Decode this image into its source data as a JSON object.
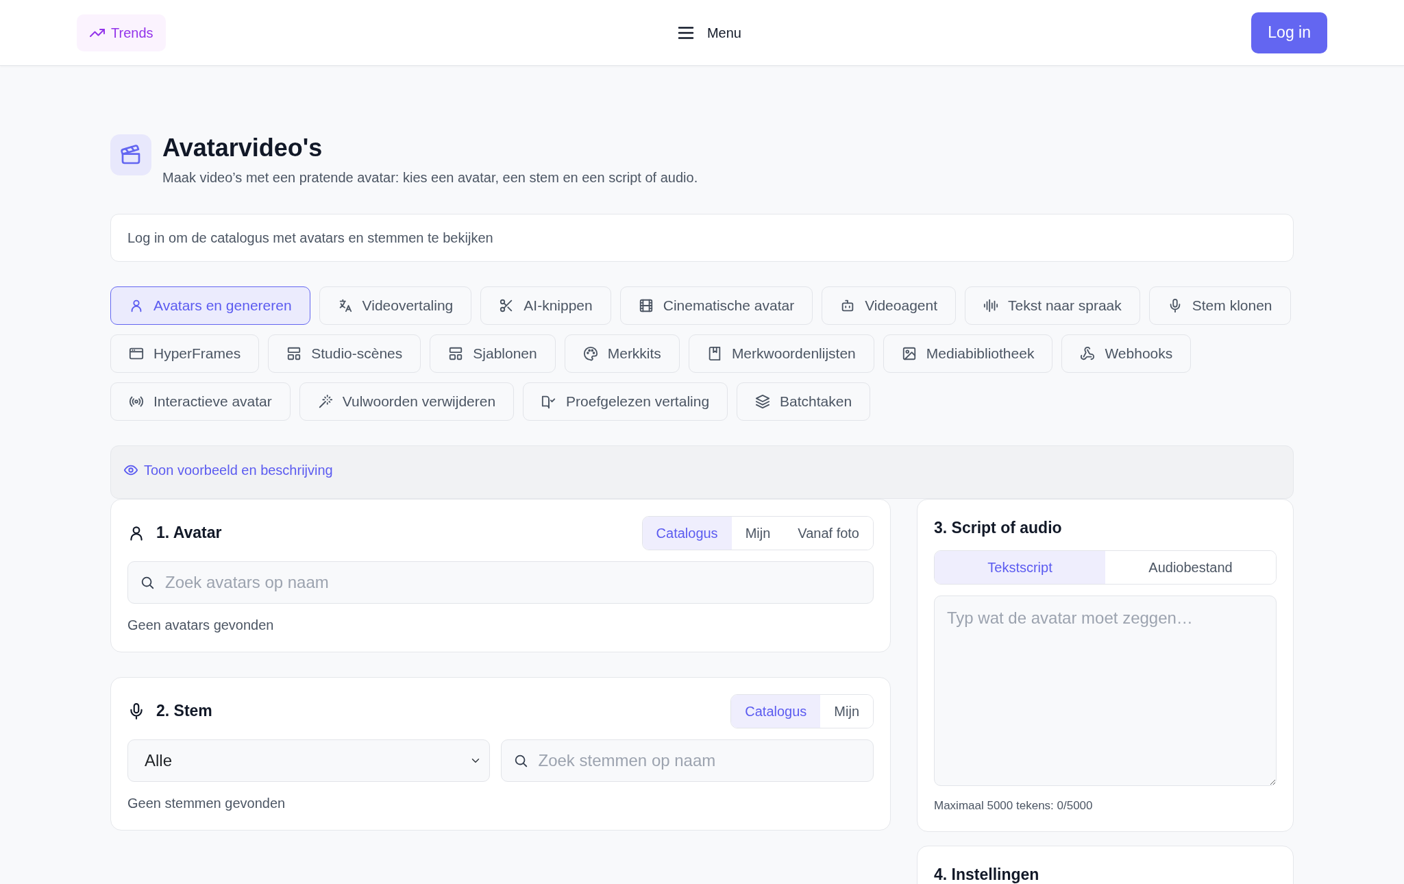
{
  "nav": {
    "trends": "Trends",
    "menu": "Menu",
    "login": "Log in"
  },
  "header": {
    "title": "Avatarvideo's",
    "subtitle": "Maak video’s met een pratende avatar: kies een avatar, een stem en een script of audio."
  },
  "notice": "Log in om de catalogus met avatars en stemmen te bekijken",
  "tabs": [
    {
      "label": "Avatars en genereren",
      "selected": true
    },
    {
      "label": "Videovertaling",
      "selected": false
    },
    {
      "label": "AI-knippen",
      "selected": false
    },
    {
      "label": "Cinematische avatar",
      "selected": false
    },
    {
      "label": "Videoagent",
      "selected": false
    },
    {
      "label": "Tekst naar spraak",
      "selected": false
    },
    {
      "label": "Stem klonen",
      "selected": false
    },
    {
      "label": "HyperFrames",
      "selected": false
    },
    {
      "label": "Studio-scènes",
      "selected": false
    },
    {
      "label": "Sjablonen",
      "selected": false
    },
    {
      "label": "Merkkits",
      "selected": false
    },
    {
      "label": "Merkwoordenlijsten",
      "selected": false
    },
    {
      "label": "Mediabibliotheek",
      "selected": false
    },
    {
      "label": "Webhooks",
      "selected": false
    },
    {
      "label": "Interactieve avatar",
      "selected": false
    },
    {
      "label": "Vulwoorden verwijderen",
      "selected": false
    },
    {
      "label": "Proefgelezen vertaling",
      "selected": false
    },
    {
      "label": "Batchtaken",
      "selected": false
    }
  ],
  "preview_toggle": "Toon voorbeeld en beschrijving",
  "avatar_card": {
    "title": "1. Avatar",
    "segments": [
      {
        "label": "Catalogus",
        "selected": true
      },
      {
        "label": "Mijn",
        "selected": false
      },
      {
        "label": "Vanaf foto",
        "selected": false
      }
    ],
    "search": {
      "placeholder": "Zoek avatars op naam"
    },
    "empty": "Geen avatars gevonden"
  },
  "voice_card": {
    "title": "2. Stem",
    "segments": [
      {
        "label": "Catalogus",
        "selected": true
      },
      {
        "label": "Mijn",
        "selected": false
      }
    ],
    "filter": {
      "value": "Alle"
    },
    "search": {
      "placeholder": "Zoek stemmen op naam"
    },
    "empty": "Geen stemmen gevonden"
  },
  "script_card": {
    "title": "3. Script of audio",
    "segments": [
      {
        "label": "Tekstscript",
        "selected": true
      },
      {
        "label": "Audiobestand",
        "selected": false
      }
    ],
    "textarea": {
      "placeholder": "Typ wat de avatar moet zeggen…"
    },
    "counter": "Maximaal 5000 tekens: 0/5000"
  },
  "settings_card": {
    "title": "4. Instellingen"
  }
}
